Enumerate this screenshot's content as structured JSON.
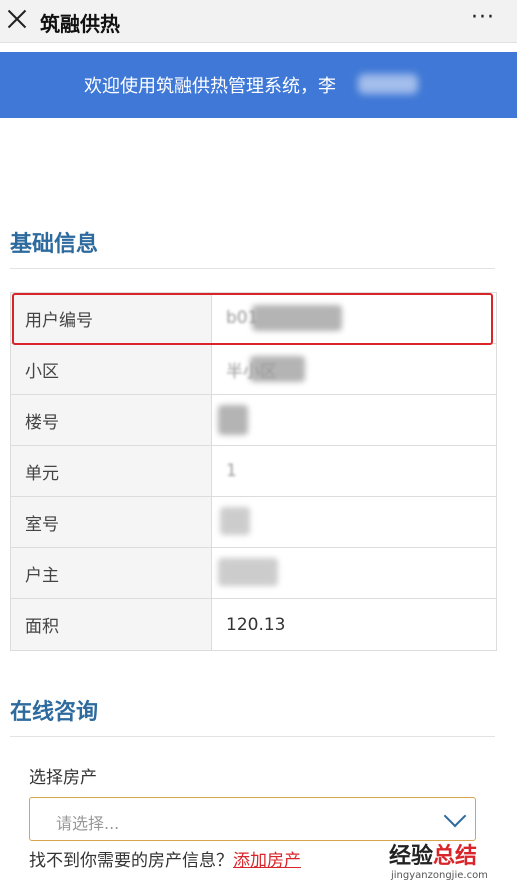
{
  "header": {
    "title": "筑融供热",
    "more_label": "···"
  },
  "banner": {
    "text": "欢迎使用筑融供热管理系统，李"
  },
  "basic_info": {
    "title": "基础信息",
    "rows": [
      {
        "label": "用户编号",
        "value": "b01"
      },
      {
        "label": "小区",
        "value": "半小区"
      },
      {
        "label": "楼号",
        "value": ""
      },
      {
        "label": "单元",
        "value": "1"
      },
      {
        "label": "室号",
        "value": ""
      },
      {
        "label": "户主",
        "value": ""
      },
      {
        "label": "面积",
        "value": "120.13"
      }
    ]
  },
  "consult": {
    "title": "在线咨询",
    "select_label": "选择房产",
    "select_placeholder": "请选择...",
    "hint_text": "找不到你需要的房产信息？",
    "add_link": "添加房产"
  },
  "watermark": {
    "main_black": "经验",
    "main_red": "总结",
    "sub": "jingyanzongjie.com"
  }
}
